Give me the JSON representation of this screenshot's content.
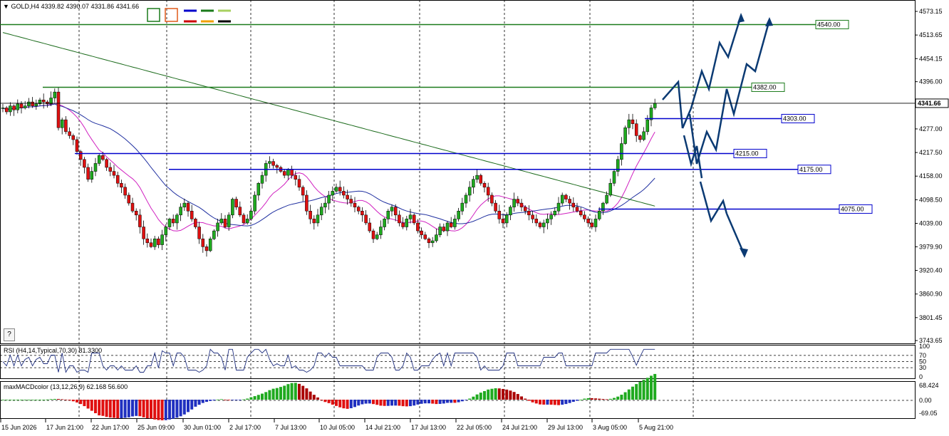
{
  "header": {
    "arrow": "▼",
    "symbol": "GOLD,H4",
    "ohlc": "4339.82 4390.07 4331.86 4341.66"
  },
  "help_button": "?",
  "toolbar_colors": {
    "box1": "#1a7a1a",
    "box2": "#e05a1a",
    "lines_top": [
      "#0000cc",
      "#1a7a1a",
      "#a8d060"
    ],
    "lines_bottom": [
      "#cc0000",
      "#f0a000",
      "#000000"
    ]
  },
  "price_axis": {
    "ticks": [
      "4573.15",
      "4513.65",
      "4454.15",
      "4396.00",
      "4336.50",
      "4277.00",
      "4217.50",
      "4158.00",
      "4098.50",
      "4039.00",
      "3979.90",
      "3920.40",
      "3860.90",
      "3801.45",
      "3743.65"
    ],
    "current_price": "4341.66",
    "ylim": [
      3743.65,
      4573.15
    ]
  },
  "time_axis": {
    "labels": [
      "15 Jun 2026",
      "17 Jun 21:00",
      "22 Jun 17:00",
      "25 Jun 09:00",
      "30 Jun 01:00",
      "2 Jul 17:00",
      "7 Jul 13:00",
      "10 Jul 05:00",
      "14 Jul 21:00",
      "17 Jul 13:00",
      "22 Jul 05:00",
      "24 Jul 21:00",
      "29 Jul 13:00",
      "3 Aug 05:00",
      "5 Aug 21:00"
    ]
  },
  "levels": [
    {
      "label": "4540.00",
      "price": 4540,
      "color": "#1a7a1a"
    },
    {
      "label": "4382.00",
      "price": 4382,
      "color": "#1a7a1a"
    },
    {
      "label": "4303.00",
      "price": 4303,
      "color": "#0000cc"
    },
    {
      "label": "4215.00",
      "price": 4215,
      "color": "#0000cc"
    },
    {
      "label": "4175.00",
      "price": 4175,
      "color": "#0000cc"
    },
    {
      "label": "4075.00",
      "price": 4075,
      "color": "#0000cc"
    }
  ],
  "rsi": {
    "label": "RSI (H4,14,Typical,70,30) 81.3300",
    "ticks": [
      "100",
      "70",
      "50",
      "30",
      "0"
    ]
  },
  "macd": {
    "label": "maxMACDcolor (13,12,26,9) 62.168 56.600",
    "ticks": [
      "68.424",
      "0.00",
      "-69.05"
    ]
  },
  "chart_data": {
    "type": "candlestick",
    "symbol": "GOLD",
    "timeframe": "H4",
    "ylim": [
      3743.65,
      4573.15
    ],
    "closes": [
      4330,
      4320,
      4335,
      4325,
      4340,
      4330,
      4335,
      4345,
      4335,
      4340,
      4350,
      4345,
      4340,
      4355,
      4370,
      4280,
      4300,
      4270,
      4260,
      4250,
      4220,
      4200,
      4180,
      4150,
      4170,
      4190,
      4210,
      4200,
      4180,
      4170,
      4160,
      4140,
      4130,
      4110,
      4090,
      4070,
      4060,
      4030,
      4000,
      3990,
      3980,
      4000,
      3985,
      4010,
      4030,
      4050,
      4040,
      4060,
      4080,
      4090,
      4070,
      4050,
      4030,
      4000,
      3980,
      3970,
      4000,
      4020,
      4040,
      4050,
      4030,
      4060,
      4100,
      4080,
      4060,
      4040,
      4050,
      4070,
      4110,
      4140,
      4160,
      4190,
      4195,
      4185,
      4180,
      4170,
      4160,
      4175,
      4160,
      4150,
      4130,
      4110,
      4070,
      4050,
      4040,
      4060,
      4080,
      4090,
      4110,
      4120,
      4130,
      4120,
      4110,
      4100,
      4090,
      4080,
      4070,
      4060,
      4040,
      4020,
      4000,
      4010,
      4030,
      4050,
      4070,
      4080,
      4060,
      4040,
      4030,
      4050,
      4060,
      4040,
      4020,
      4010,
      4000,
      3990,
      3995,
      4010,
      4030,
      4020,
      4040,
      4030,
      4050,
      4070,
      4090,
      4110,
      4130,
      4150,
      4160,
      4140,
      4130,
      4110,
      4090,
      4070,
      4050,
      4040,
      4060,
      4080,
      4100,
      4090,
      4080,
      4070,
      4060,
      4050,
      4040,
      4030,
      4040,
      4050,
      4060,
      4070,
      4090,
      4110,
      4100,
      4090,
      4080,
      4070,
      4060,
      4050,
      4040,
      4030,
      4050,
      4070,
      4090,
      4110,
      4140,
      4170,
      4200,
      4240,
      4280,
      4300,
      4290,
      4260,
      4250,
      4270,
      4300,
      4330,
      4341.66
    ]
  }
}
